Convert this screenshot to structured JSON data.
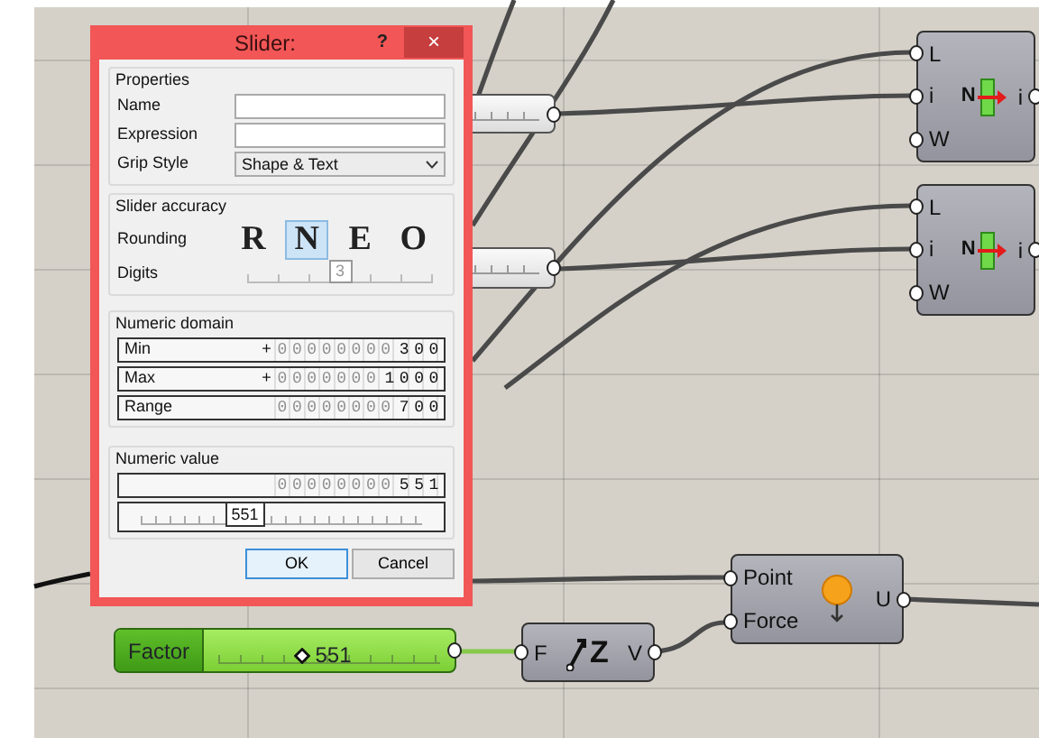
{
  "dialog": {
    "title": "Slider:",
    "help": "?",
    "close": "×",
    "properties": {
      "heading": "Properties",
      "fields": [
        {
          "label": "Name",
          "kind": "text"
        },
        {
          "label": "Expression",
          "kind": "text"
        },
        {
          "label": "Grip Style",
          "kind": "select",
          "value": "Shape & Text"
        }
      ]
    },
    "accuracy": {
      "heading": "Slider accuracy",
      "rounding_label": "Rounding",
      "rounding": [
        {
          "label": "R",
          "selected": false
        },
        {
          "label": "N",
          "selected": true
        },
        {
          "label": "E",
          "selected": false
        },
        {
          "label": "O",
          "selected": false
        }
      ],
      "digits_label": "Digits",
      "digits_slider": {
        "value": "3",
        "level": 0.5
      }
    },
    "domain": {
      "heading": "Numeric domain",
      "rows": [
        {
          "label": "Min",
          "sign": "+",
          "faded": "00000000",
          "value": "300"
        },
        {
          "label": "Max",
          "sign": "+",
          "faded": "0000000",
          "value": "1000"
        },
        {
          "label": "Range",
          "faded": "00000000",
          "value": "700"
        }
      ]
    },
    "numeric_value": {
      "heading": "Numeric value",
      "faded": "00000000",
      "value": "551",
      "slider_value": "551",
      "level": 0.37
    },
    "buttons": [
      {
        "label": "OK",
        "selected": true
      },
      {
        "label": "Cancel",
        "selected": false
      }
    ]
  },
  "canvas": {
    "components": [
      {
        "kind": "slider_stub"
      },
      {
        "kind": "slider_stub"
      },
      {
        "kind": "list_node",
        "icon_text": "N",
        "inputs": [
          "L",
          "i",
          "W"
        ],
        "outputs": [
          "i"
        ]
      },
      {
        "kind": "list_node",
        "icon_text": "N",
        "inputs": [
          "L",
          "i",
          "W"
        ],
        "outputs": [
          "i"
        ]
      },
      {
        "kind": "point_node",
        "inputs": [
          "Point",
          "Force"
        ],
        "outputs": [
          "U"
        ]
      },
      {
        "kind": "number_slider",
        "label": "Factor",
        "value": "551",
        "level": 0.38
      },
      {
        "kind": "vector_node",
        "icon_text": "Z",
        "inputs": [
          "F"
        ],
        "outputs": [
          "V"
        ]
      }
    ]
  }
}
